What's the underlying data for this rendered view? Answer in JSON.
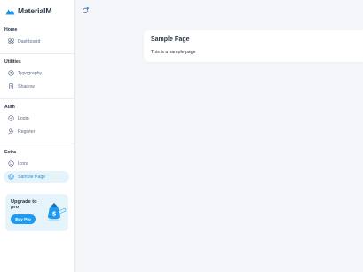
{
  "brand": {
    "name": "MaterialM"
  },
  "sidebar": {
    "sections": [
      {
        "title": "Home",
        "items": [
          {
            "label": "Dashboard",
            "icon": "layout-grid-icon"
          }
        ]
      },
      {
        "title": "Utilities",
        "items": [
          {
            "label": "Typography",
            "icon": "text-size-icon"
          },
          {
            "label": "Shadow",
            "icon": "shadow-icon"
          }
        ]
      },
      {
        "title": "Auth",
        "items": [
          {
            "label": "Login",
            "icon": "login-icon"
          },
          {
            "label": "Register",
            "icon": "user-plus-icon"
          }
        ]
      },
      {
        "title": "Extra",
        "items": [
          {
            "label": "Icons",
            "icon": "mood-icon"
          },
          {
            "label": "Sample Page",
            "icon": "aperture-icon",
            "active": true
          }
        ]
      }
    ],
    "promo": {
      "title": "Upgrade to pro",
      "button": "Buy Pro"
    }
  },
  "card": {
    "title": "Sample Page",
    "text": "This is a sample page"
  },
  "colors": {
    "accent": "#1e9bf0",
    "active_bg": "#e5f3fb",
    "text_dark": "#2a3547",
    "text_muted": "#5a6a85",
    "page_bg": "#f4f6fa"
  }
}
